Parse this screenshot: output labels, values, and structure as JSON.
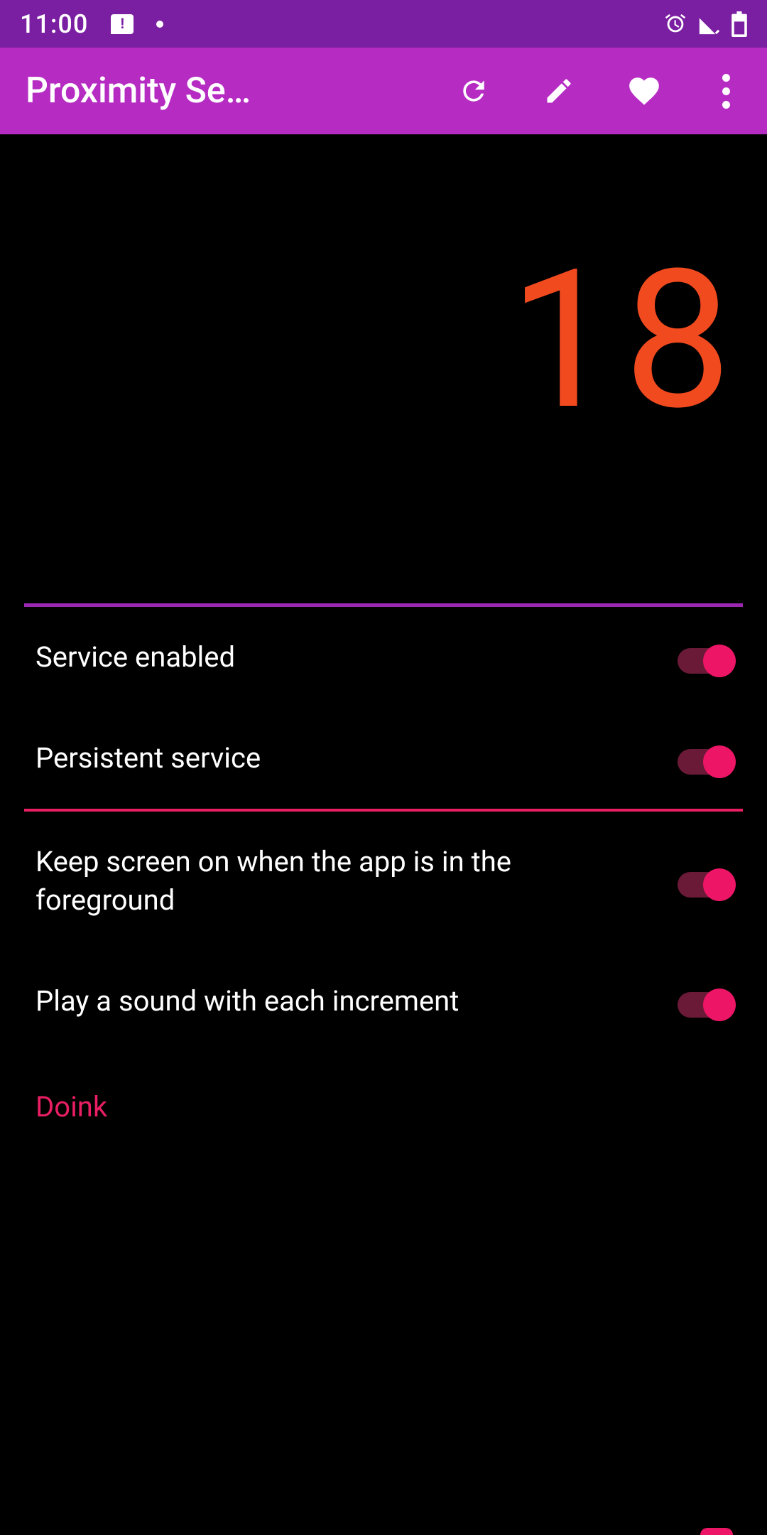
{
  "status": {
    "time": "11:00"
  },
  "app": {
    "title": "Proximity Sens…"
  },
  "counter": {
    "value": "18"
  },
  "settings": {
    "service_enabled": {
      "label": "Service enabled",
      "on": true
    },
    "persistent_service": {
      "label": "Persistent service",
      "on": true
    },
    "keep_screen": {
      "label": "Keep screen on when the app is in the foreground",
      "on": true
    },
    "play_sound": {
      "label": "Play a sound with each increment",
      "on": true
    },
    "sound_name": "Doink"
  },
  "colors": {
    "status_bar": "#7b1fa2",
    "app_bar": "#b62cc3",
    "counter": "#f14a1f",
    "accent_pink": "#ed1566",
    "divider_purple": "#9c27b0",
    "divider_pink": "#e91e63"
  }
}
